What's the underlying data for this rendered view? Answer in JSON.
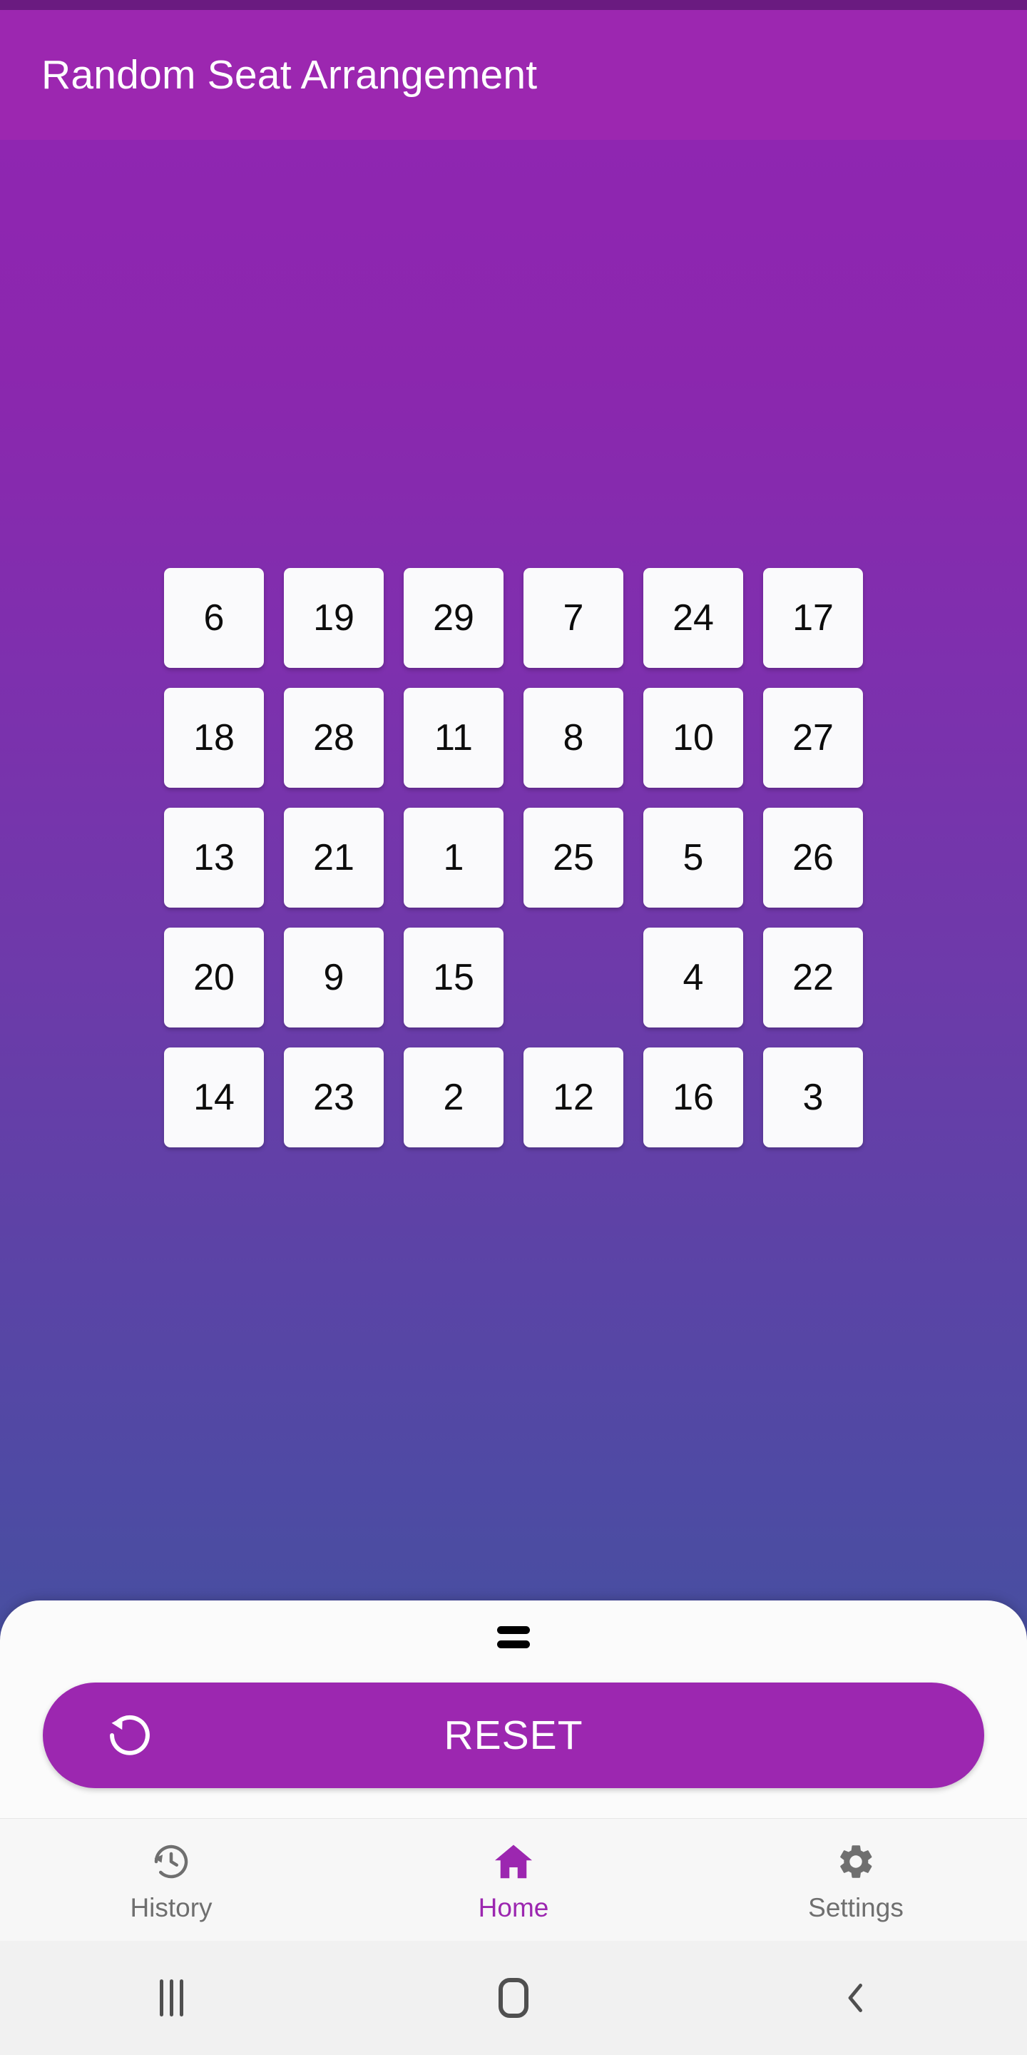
{
  "app": {
    "title": "Random Seat Arrangement",
    "accent_color": "#9C27B0",
    "status_bar_color": "#6A1B80",
    "gradient_top": "#8F26B1",
    "gradient_bottom": "#41539D"
  },
  "seat_grid": {
    "columns": 6,
    "rows": 5,
    "total_seats": 29,
    "seats": [
      "6",
      "19",
      "29",
      "7",
      "24",
      "17",
      "18",
      "28",
      "11",
      "8",
      "10",
      "27",
      "13",
      "21",
      "1",
      "25",
      "5",
      "26",
      "20",
      "9",
      "15",
      "",
      "4",
      "22",
      "14",
      "23",
      "2",
      "12",
      "16",
      "3"
    ]
  },
  "bottom_sheet": {
    "handle": "drag-handle",
    "reset": {
      "label": "RESET",
      "icon": "rotate-left-icon"
    }
  },
  "bottom_nav": {
    "items": [
      {
        "label": "History",
        "icon": "history-icon",
        "active": false
      },
      {
        "label": "Home",
        "icon": "home-icon",
        "active": true
      },
      {
        "label": "Settings",
        "icon": "gear-icon",
        "active": false
      }
    ]
  },
  "system_nav": {
    "recents": "recents-icon",
    "home": "system-home-icon",
    "back": "back-icon"
  }
}
